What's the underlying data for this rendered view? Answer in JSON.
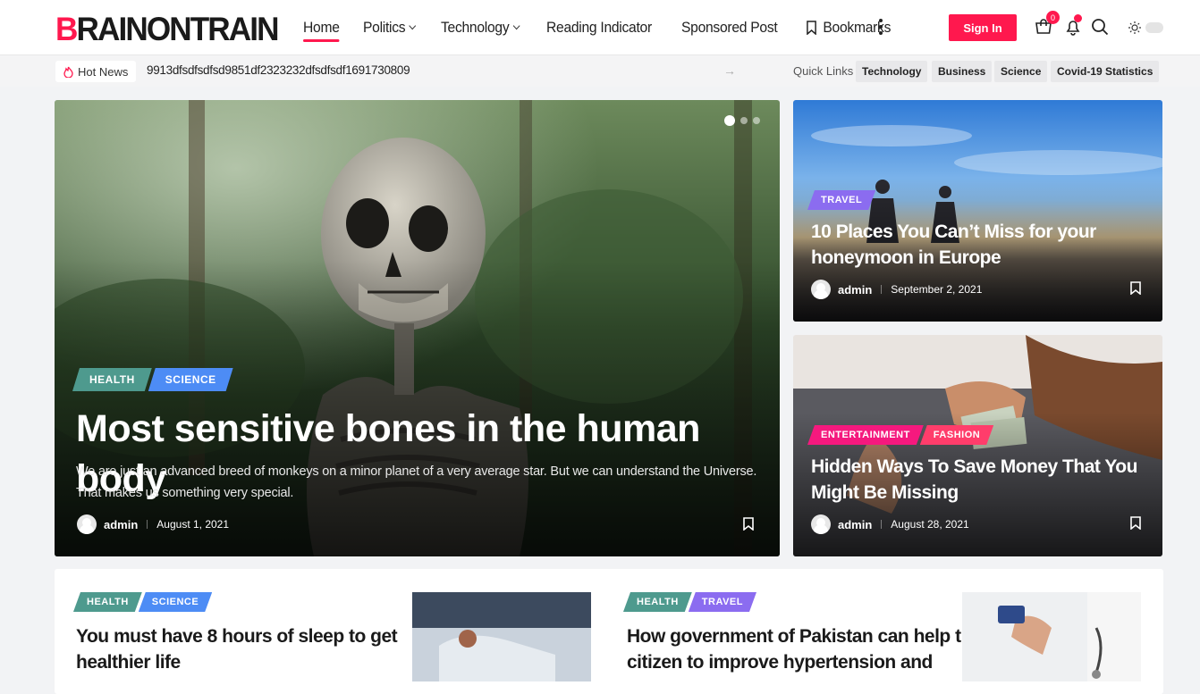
{
  "brand": {
    "first_letter": "B",
    "rest": "RAINONTRAIN",
    "accent": "#ff184e"
  },
  "nav": {
    "home": "Home",
    "politics": "Politics",
    "technology": "Technology",
    "reading": "Reading Indicator",
    "sponsored": "Sponsored Post",
    "bookmarks": "Bookmarks"
  },
  "header": {
    "signin": "Sign In",
    "cart_count": "0"
  },
  "subbar": {
    "hot_news": "Hot News",
    "ticker": "9913dfsdfsdfsd9851df2323232dfsdfsdf1691730809",
    "quick_links_label": "Quick Links",
    "quick_links": [
      "Technology",
      "Business",
      "Science",
      "Covid-19 Statistics"
    ]
  },
  "hero": {
    "tags": [
      "HEALTH",
      "SCIENCE"
    ],
    "title": "Most sensitive bones in the human body",
    "excerpt_line1": "We are just an advanced breed of monkeys on a minor planet of a very average star. But we can understand the Universe.",
    "excerpt_line2": "That makes us something very special.",
    "author": "admin",
    "date": "August 1, 2021"
  },
  "side1": {
    "tag": "TRAVEL",
    "title_line1": "10 Places You Can’t Miss for your",
    "title_line2": "honeymoon in Europe",
    "author": "admin",
    "date": "September 2, 2021"
  },
  "side2": {
    "tags": [
      "ENTERTAINMENT",
      "FASHION"
    ],
    "title_line1": "Hidden Ways To Save Money That You",
    "title_line2": "Might Be Missing",
    "author": "admin",
    "date": "August 28, 2021"
  },
  "bottom": [
    {
      "tags": [
        "HEALTH",
        "SCIENCE"
      ],
      "title_line1": "You must have 8 hours of sleep to get",
      "title_line2": "healthier life"
    },
    {
      "tags": [
        "HEALTH",
        "TRAVEL"
      ],
      "title_line1": "How government of Pakistan can help the",
      "title_line2": "citizen to improve hypertension and"
    }
  ],
  "colors": {
    "health": "#4e9a8e",
    "science": "#4d8cf5",
    "travel": "#8b6cf0",
    "entertainment": "#f5197e",
    "fashion": "#ff3d6b"
  }
}
